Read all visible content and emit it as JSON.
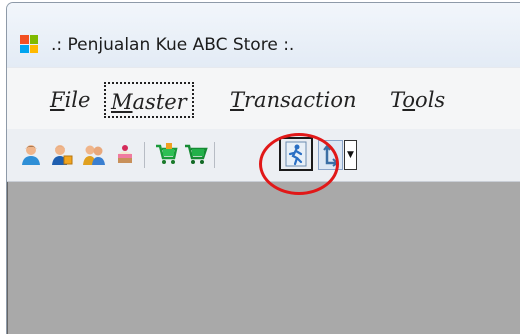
{
  "window": {
    "title": ".: Penjualan Kue ABC Store :."
  },
  "app_icon": {
    "name": "app-logo-icon",
    "colors": [
      "#f25022",
      "#7fba00",
      "#00a4ef",
      "#ffb900"
    ]
  },
  "menu": {
    "items": [
      {
        "label": "File",
        "accel": "F",
        "rest": "ile"
      },
      {
        "label": "Master",
        "accel": "M",
        "rest": "aster"
      },
      {
        "label": "Transaction",
        "accel": "T",
        "rest": "ransaction"
      },
      {
        "label": "Tools",
        "pre": "T",
        "accel": "o",
        "rest": "ols"
      }
    ]
  },
  "toolbar": {
    "buttons": [
      {
        "icon": "user-icon"
      },
      {
        "icon": "user-box-icon"
      },
      {
        "icon": "users-group-icon"
      },
      {
        "icon": "cake-icon"
      },
      {
        "icon": "cart-in-icon"
      },
      {
        "icon": "cart-icon"
      },
      {
        "icon": "exit-running-man-icon",
        "state": "pressed"
      },
      {
        "icon": "update-icon"
      },
      {
        "icon": "chevron-down-icon"
      }
    ]
  },
  "colors": {
    "highlight_ring": "#e11818",
    "workspace": "#a9a9a9"
  }
}
